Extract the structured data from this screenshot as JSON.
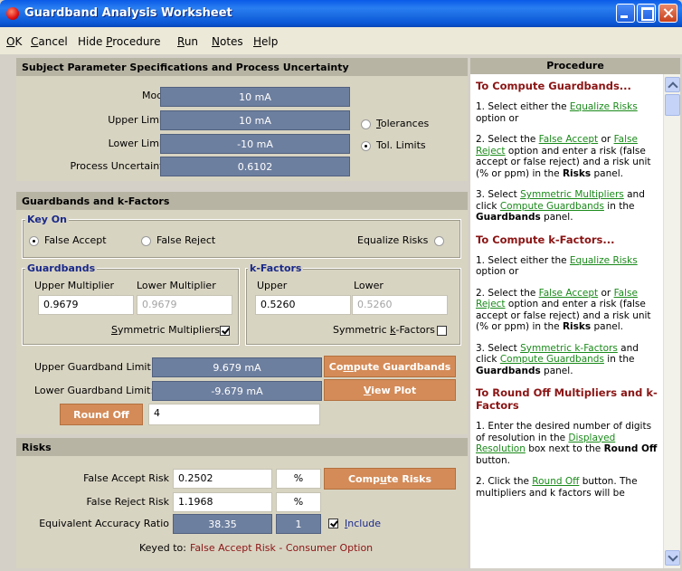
{
  "window": {
    "title": "Guardband Analysis Worksheet"
  },
  "menu": [
    {
      "label": "OK",
      "key": "O"
    },
    {
      "label": "Cancel",
      "key": "C"
    },
    {
      "label": "Hide Procedure",
      "key": "P"
    },
    {
      "label": "Run",
      "key": "R"
    },
    {
      "label": "Notes",
      "key": "N"
    },
    {
      "label": "Help",
      "key": "H"
    }
  ],
  "spec": {
    "title": "Subject Parameter Specifications and Process Uncertainty",
    "mode_label": "Mode",
    "mode_value": "10 mA",
    "upper_limit_label": "Upper Limit:",
    "upper_limit_value": "10 mA",
    "lower_limit_label": "Lower Limit:",
    "lower_limit_value": "-10 mA",
    "process_uncertainty_label": "Process Uncertainty",
    "process_uncertainty_value": "0.6102",
    "tolerances_label": "Tolerances",
    "tol_limits_label": "Tol. Limits",
    "selected": "Tol. Limits"
  },
  "guardbands": {
    "title": "Guardbands and k-Factors",
    "key_on_title": "Key On",
    "false_accept_label": "False Accept",
    "false_reject_label": "False Reject",
    "equalize_risks_label": "Equalize Risks",
    "key_on_selected": "False Accept",
    "gb_group_title": "Guardbands",
    "upper_multiplier_label": "Upper Multiplier",
    "lower_multiplier_label": "Lower Multiplier",
    "upper_multiplier_value": "0.9679",
    "lower_multiplier_value": "0.9679",
    "symmetric_multipliers_label": "Symmetric Multipliers",
    "symmetric_multipliers_checked": true,
    "kf_group_title": "k-Factors",
    "kf_upper_label": "Upper",
    "kf_lower_label": "Lower",
    "kf_upper_value": "0.5260",
    "kf_lower_value": "0.5260",
    "symmetric_kfactors_label": "Symmetric k-Factors",
    "symmetric_kfactors_checked": false,
    "upper_gb_limit_label": "Upper Guardband Limit:",
    "upper_gb_limit_value": "9.679 mA",
    "lower_gb_limit_label": "Lower Guardband Limit:",
    "lower_gb_limit_value": "-9.679 mA",
    "compute_guardbands_label": "Compute Guardbands",
    "view_plot_label": "View Plot",
    "round_off_label": "Round Off",
    "round_off_value": "4"
  },
  "risks": {
    "title": "Risks",
    "false_accept_risk_label": "False Accept Risk",
    "false_accept_risk_value": "0.2502",
    "false_accept_unit": "%",
    "false_reject_risk_label": "False Reject Risk",
    "false_reject_risk_value": "1.1968",
    "false_reject_unit": "%",
    "compute_risks_label": "Compute Risks",
    "ear_label": "Equivalent Accuracy Ratio",
    "ear_value": "38.35",
    "ear_ratio": "1",
    "include_label": "Include",
    "include_checked": true,
    "keyed_to_label": "Keyed to:",
    "keyed_to_value": "False Accept Risk - Consumer Option"
  },
  "procedure": {
    "title": "Procedure",
    "s1_title": "To Compute Guardbands...",
    "s1_p1_a": "1. Select either the ",
    "s1_p1_link": "Equalize Risks",
    "s1_p1_b": " option or",
    "s1_p2_a": "2. Select the ",
    "s1_p2_link1": "False Accept",
    "s1_p2_or": " or ",
    "s1_p2_link2": "False Reject",
    "s1_p2_b": " option and enter a risk (false accept or false reject) and a risk unit (% or ppm) in the ",
    "s1_p2_bold": "Risks",
    "s1_p2_c": " panel.",
    "s1_p3_a": "3. Select ",
    "s1_p3_link1": "Symmetric Multipliers",
    "s1_p3_b": " and click ",
    "s1_p3_link2": "Compute Guardbands",
    "s1_p3_c": " in the ",
    "s1_p3_bold": "Guardbands",
    "s1_p3_d": " panel.",
    "s2_title": "To Compute k-Factors...",
    "s2_p1_a": "1. Select either the ",
    "s2_p1_link": "Equalize Risks",
    "s2_p1_b": " option or",
    "s2_p2_a": "2. Select the ",
    "s2_p2_link1": "False Accept",
    "s2_p2_or": " or ",
    "s2_p2_link2": "False Reject",
    "s2_p2_b": " option and enter a risk (false accept or false reject) and a risk unit (% or ppm) in the ",
    "s2_p2_bold": "Risks",
    "s2_p2_c": " panel.",
    "s2_p3_a": "3. Select ",
    "s2_p3_link1": "Symmetric k-Factors",
    "s2_p3_b": " and click ",
    "s2_p3_link2": "Compute Guardbands",
    "s2_p3_c": " in the ",
    "s2_p3_bold": "Guardbands",
    "s2_p3_d": " panel.",
    "s3_title": "To Round Off Multipliers and k-Factors",
    "s3_p1_a": "1. Enter the desired number of digits of resolution in the ",
    "s3_p1_link": "Displayed Resolution",
    "s3_p1_b": " box next to the ",
    "s3_p1_bold": "Round Off",
    "s3_p1_c": " button.",
    "s3_p2_a": "2. Click the ",
    "s3_p2_link": "Round Off",
    "s3_p2_b": " button.  The multipliers and k factors will be"
  }
}
